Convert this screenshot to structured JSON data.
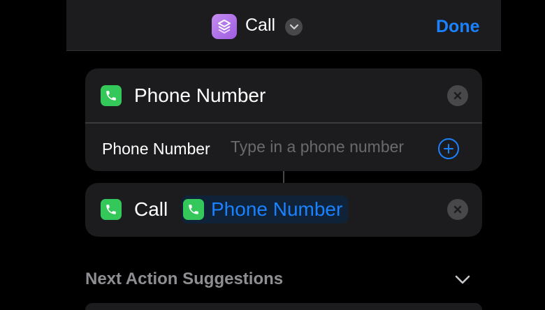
{
  "header": {
    "app_icon": "shortcuts-icon",
    "title": "Call",
    "menu_icon": "chevron-down-icon",
    "done_label": "Done"
  },
  "phone_action": {
    "icon": "phone-icon",
    "title": "Phone Number",
    "clear_icon": "close-icon",
    "field_label": "Phone Number",
    "field_value": "",
    "field_placeholder": "Type in a phone number",
    "add_icon": "plus-circle-icon"
  },
  "call_action": {
    "icon": "phone-icon",
    "title": "Call",
    "token_icon": "phone-icon",
    "token_label": "Phone Number",
    "clear_icon": "close-icon"
  },
  "suggestions": {
    "label": "Next Action Suggestions",
    "toggle_icon": "chevron-down-icon"
  },
  "colors": {
    "accent": "#1a82ff",
    "phone_green": "#34c759",
    "card_bg": "#1c1c1e",
    "app_icon_purple": "#b070e8"
  }
}
